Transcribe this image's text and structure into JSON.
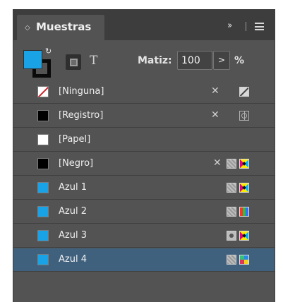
{
  "panel": {
    "title": "Muestras",
    "tab_chevron_icon": "tab-collapse-chevron",
    "collapse_icon": "double-chevron-right",
    "menu_icon": "hamburger-menu"
  },
  "fill_color": "#1aa2e6",
  "stroke_color": "#0a0a0a",
  "format_text_glyph": "T",
  "tint": {
    "label": "Matiz:",
    "value": "100",
    "arrow": ">",
    "unit": "%"
  },
  "swatches": [
    {
      "name": "[Ninguna]",
      "color": "none",
      "icons": [
        "no-edit",
        "spot-none"
      ]
    },
    {
      "name": "[Registro]",
      "color": "#000000",
      "icons": [
        "no-edit",
        "registration"
      ]
    },
    {
      "name": "[Papel]",
      "color": "#ffffff",
      "icons": []
    },
    {
      "name": "[Negro]",
      "color": "#000000",
      "icons": [
        "no-edit",
        "process",
        "cmyk"
      ]
    },
    {
      "name": "Azul 1",
      "color": "#1aa2e6",
      "icons": [
        "process",
        "cmyk"
      ]
    },
    {
      "name": "Azul 2",
      "color": "#1aa2e6",
      "icons": [
        "process",
        "rgb"
      ]
    },
    {
      "name": "Azul 3",
      "color": "#1aa2e6",
      "icons": [
        "spot",
        "cmyk"
      ]
    },
    {
      "name": "Azul 4",
      "color": "#1aa2e6",
      "icons": [
        "process",
        "lab"
      ],
      "selected": true
    }
  ]
}
